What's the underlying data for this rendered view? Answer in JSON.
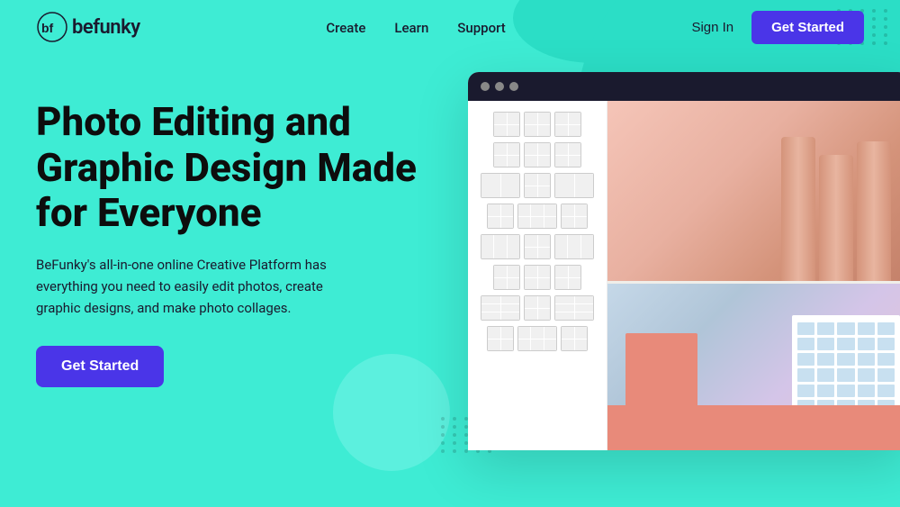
{
  "navbar": {
    "logo_text": "befunky",
    "nav_links": [
      {
        "label": "Create",
        "href": "#"
      },
      {
        "label": "Learn",
        "href": "#"
      },
      {
        "label": "Support",
        "href": "#"
      }
    ],
    "sign_in_label": "Sign In",
    "get_started_label": "Get Started"
  },
  "hero": {
    "title": "Photo Editing and Graphic Design Made for Everyone",
    "subtitle": "BeFunky's all-in-one online Creative Platform has everything you need to easily edit photos, create graphic designs, and make photo collages.",
    "get_started_label": "Get Started"
  },
  "colors": {
    "bg": "#3EECD4",
    "accent": "#4A35E8",
    "dark": "#1a1a2e"
  }
}
